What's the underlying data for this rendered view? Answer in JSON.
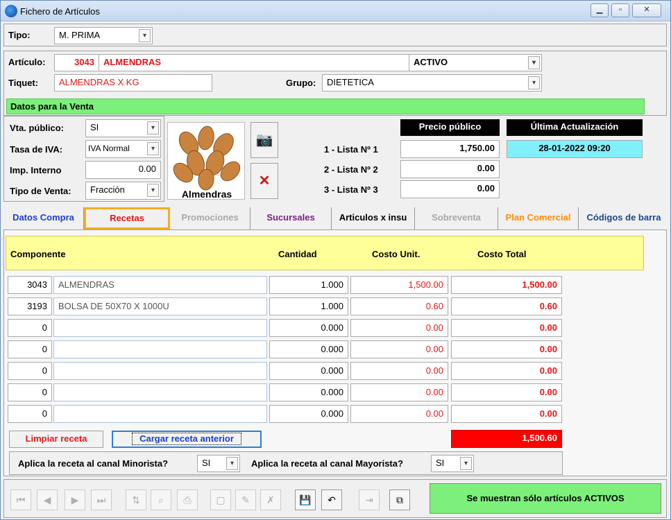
{
  "window": {
    "title": "Fichero de Artículos"
  },
  "tipo": {
    "label": "Tipo:",
    "value": "M. PRIMA"
  },
  "articulo": {
    "label": "Artículo:",
    "code": "3043",
    "name": "ALMENDRAS",
    "status": "ACTIVO"
  },
  "tiquet": {
    "label": "Tiquet:",
    "value": "ALMENDRAS X KG"
  },
  "grupo": {
    "label": "Grupo:",
    "value": "DIETETICA"
  },
  "venta": {
    "section_title": "Datos para la Venta",
    "vta_publico": {
      "label": "Vta. público:",
      "value": "SI"
    },
    "tasa_iva": {
      "label": "Tasa de IVA:",
      "value": "IVA Normal"
    },
    "imp_interno": {
      "label": "Imp. Interno",
      "value": "0.00"
    },
    "tipo_venta": {
      "label": "Tipo de Venta:",
      "value": "Fracción"
    },
    "photo_caption": "Almendras",
    "precio_header": "Precio público",
    "actualizacion_header": "Última Actualización",
    "actualizacion_value": "28-01-2022 09:20",
    "listas": [
      {
        "label": "1 - Lista Nº 1",
        "value": "1,750.00"
      },
      {
        "label": "2 - Lista Nº 2",
        "value": "0.00"
      },
      {
        "label": "3 - Lista Nº 3",
        "value": "0.00"
      }
    ]
  },
  "tabs": [
    {
      "label": "Datos Compra",
      "color": "#1a3fcc"
    },
    {
      "label": "Recetas",
      "color": "#e01818"
    },
    {
      "label": "Promociones",
      "color": "#a8a8a8"
    },
    {
      "label": "Sucursales",
      "color": "#7a1f8a"
    },
    {
      "label": "Articulos x insu",
      "color": "#000000"
    },
    {
      "label": "Sobreventa",
      "color": "#a8a8a8"
    },
    {
      "label": "Plan Comercial",
      "color": "#ff8c00"
    },
    {
      "label": "Códigos de barra",
      "color": "#1a4a8a"
    }
  ],
  "recipe": {
    "headers": {
      "componente": "Componente",
      "cantidad": "Cantidad",
      "costo_unit": "Costo Unit.",
      "costo_total": "Costo Total"
    },
    "rows": [
      {
        "code": "3043",
        "desc": "ALMENDRAS",
        "qty": "1.000",
        "unit": "1,500.00",
        "total": "1,500.00"
      },
      {
        "code": "3193",
        "desc": "BOLSA DE 50X70 X 1000U",
        "qty": "1.000",
        "unit": "0.60",
        "total": "0.60"
      },
      {
        "code": "0",
        "desc": "",
        "qty": "0.000",
        "unit": "0.00",
        "total": "0.00"
      },
      {
        "code": "0",
        "desc": "",
        "qty": "0.000",
        "unit": "0.00",
        "total": "0.00"
      },
      {
        "code": "0",
        "desc": "",
        "qty": "0.000",
        "unit": "0.00",
        "total": "0.00"
      },
      {
        "code": "0",
        "desc": "",
        "qty": "0.000",
        "unit": "0.00",
        "total": "0.00"
      },
      {
        "code": "0",
        "desc": "",
        "qty": "0.000",
        "unit": "0.00",
        "total": "0.00"
      }
    ],
    "limpiar_label": "Limpiar receta",
    "cargar_label": "Cargar receta anterior",
    "grand_total": "1,500.60",
    "minorista_label": "Aplica la receta al canal Minorista?",
    "minorista_value": "SI",
    "mayorista_label": "Aplica la receta al canal Mayorista?",
    "mayorista_value": "SI"
  },
  "toolbar": {
    "status_label": "Se muestran sólo artículos ACTIVOS",
    "icons": [
      "first-icon",
      "prev-icon",
      "next-icon",
      "last-icon",
      "sort-icon",
      "search-icon",
      "print-icon",
      "new-icon",
      "edit-icon",
      "delete-icon",
      "save-icon",
      "undo-icon",
      "exit-icon",
      "copy-icon"
    ]
  },
  "colors": {
    "green": "#7cf07a",
    "yellow": "#ffff99",
    "red": "#ff0000",
    "accent_tab_border": "#f0b020"
  }
}
